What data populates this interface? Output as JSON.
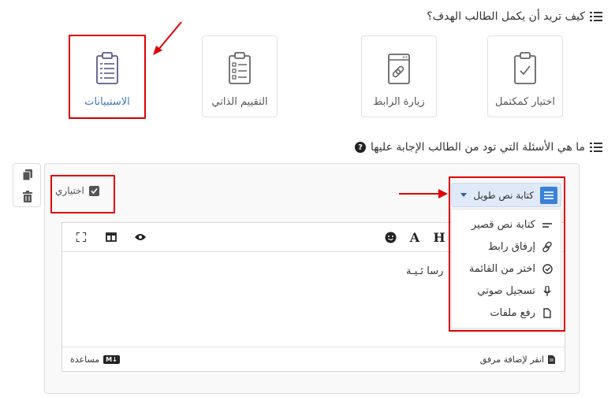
{
  "section1": {
    "title": "كيف تريد أن يكمل الطالب الهدف؟"
  },
  "cards": [
    {
      "label": "اختيار كمكتمل",
      "icon": "clipboard-check-icon"
    },
    {
      "label": "زيارة الرابط",
      "icon": "link-icon"
    },
    {
      "label": "التقييم الذاتي",
      "icon": "checklist-icon"
    },
    {
      "label": "الاستبيانات",
      "icon": "clipboard-list-icon",
      "selected": true
    }
  ],
  "section2": {
    "title": "ما هي الأسئلة التي تود من الطالب الإجابة عليها"
  },
  "question": {
    "optional_label": "اختياري",
    "type_selected": "كتابة نص طويل",
    "type_options": [
      {
        "label": "كتابة نص قصير",
        "icon": "short-text-icon"
      },
      {
        "label": "إرفاق رابط",
        "icon": "link-icon"
      },
      {
        "label": "اختر من القائمة",
        "icon": "check-circle-icon"
      },
      {
        "label": "تسجيل صوتي",
        "icon": "microphone-icon"
      },
      {
        "label": "رفع ملفات",
        "icon": "file-icon"
      }
    ],
    "editor_text": "رسا ئـيـة",
    "toolbar": {
      "heading": "H",
      "font": "A"
    },
    "footer_attach": "انقر لإضافة مرفق",
    "footer_help": "مساعدة",
    "markdown_badge": "M↓"
  },
  "colors": {
    "accent": "#3b82d6",
    "highlight": "#e00000",
    "selected_text": "#3a78b8"
  }
}
